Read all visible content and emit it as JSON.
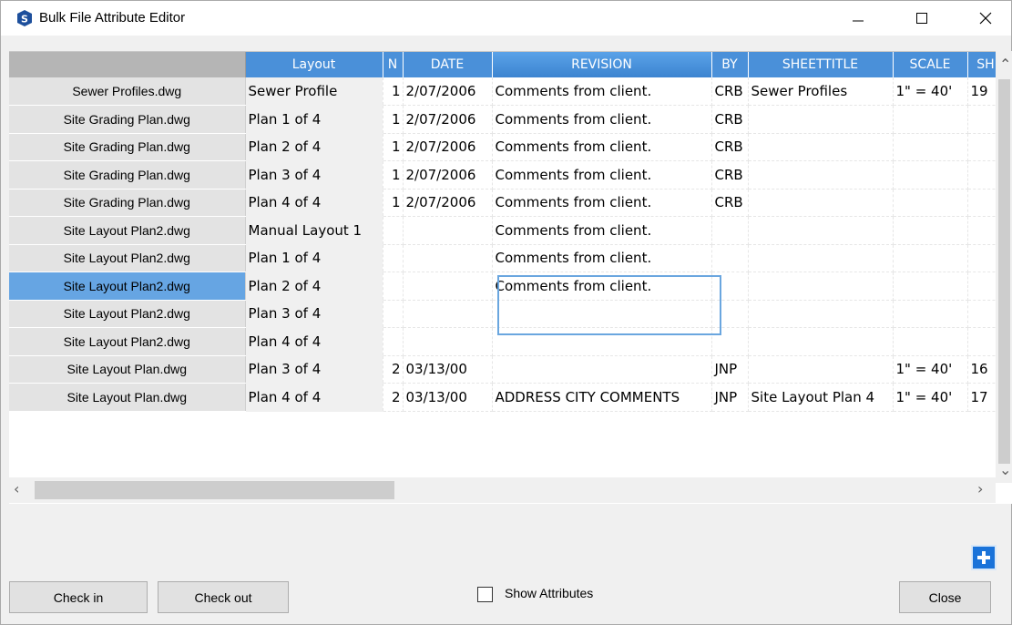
{
  "window": {
    "title": "Bulk File Attribute Editor",
    "minimize": "—",
    "maximize": "☐",
    "close": "✕"
  },
  "grid": {
    "columns": [
      "Layout",
      "N",
      "DATE",
      "REVISION",
      "BY",
      "SHEETTITLE",
      "SCALE",
      "SH"
    ],
    "rows": [
      {
        "file": "Sewer Profiles.dwg",
        "layout": "Sewer Profile",
        "n": "1",
        "date": "2/07/2006",
        "revision": "Comments from client.",
        "by": "CRB",
        "sheettitle": "Sewer Profiles",
        "scale": "1\" = 40'",
        "sh": "19"
      },
      {
        "file": "Site Grading Plan.dwg",
        "layout": "Plan 1 of 4",
        "n": "1",
        "date": "2/07/2006",
        "revision": "Comments from client.",
        "by": "CRB",
        "sheettitle": "",
        "scale": "",
        "sh": ""
      },
      {
        "file": "Site Grading Plan.dwg",
        "layout": "Plan 2 of 4",
        "n": "1",
        "date": "2/07/2006",
        "revision": "Comments from client.",
        "by": "CRB",
        "sheettitle": "",
        "scale": "",
        "sh": ""
      },
      {
        "file": "Site Grading Plan.dwg",
        "layout": "Plan 3 of 4",
        "n": "1",
        "date": "2/07/2006",
        "revision": "Comments from client.",
        "by": "CRB",
        "sheettitle": "",
        "scale": "",
        "sh": ""
      },
      {
        "file": "Site Grading Plan.dwg",
        "layout": "Plan 4 of 4",
        "n": "1",
        "date": "2/07/2006",
        "revision": "Comments from client.",
        "by": "CRB",
        "sheettitle": "",
        "scale": "",
        "sh": ""
      },
      {
        "file": "Site Layout Plan2.dwg",
        "layout": "Manual Layout 1",
        "n": "",
        "date": "",
        "revision": "Comments from client.",
        "by": "",
        "sheettitle": "",
        "scale": "",
        "sh": ""
      },
      {
        "file": "Site Layout Plan2.dwg",
        "layout": "Plan 1 of 4",
        "n": "",
        "date": "",
        "revision": "Comments from client.",
        "by": "",
        "sheettitle": "",
        "scale": "",
        "sh": ""
      },
      {
        "file": "Site Layout Plan2.dwg",
        "layout": "Plan 2 of 4",
        "n": "",
        "date": "",
        "revision": "Comments from client.",
        "by": "",
        "sheettitle": "",
        "scale": "",
        "sh": "",
        "selected": true
      },
      {
        "file": "Site Layout Plan2.dwg",
        "layout": "Plan 3 of 4",
        "n": "",
        "date": "",
        "revision": "",
        "by": "",
        "sheettitle": "",
        "scale": "",
        "sh": ""
      },
      {
        "file": "Site Layout Plan2.dwg",
        "layout": "Plan 4 of 4",
        "n": "",
        "date": "",
        "revision": "",
        "by": "",
        "sheettitle": "",
        "scale": "",
        "sh": ""
      },
      {
        "file": "Site Layout Plan.dwg",
        "layout": "Plan 3 of 4",
        "n": "2",
        "date": "03/13/00",
        "revision": "",
        "by": "JNP",
        "sheettitle": "",
        "scale": "1\" = 40'",
        "sh": "16"
      },
      {
        "file": "Site Layout Plan.dwg",
        "layout": "Plan 4 of 4",
        "n": "2",
        "date": "03/13/00",
        "revision": "ADDRESS CITY COMMENTS",
        "by": "JNP",
        "sheettitle": "Site Layout Plan 4",
        "scale": "1\" = 40'",
        "sh": "17"
      }
    ]
  },
  "buttons": {
    "check_in": "Check in",
    "check_out": "Check out",
    "close": "Close"
  },
  "show_attributes": {
    "label": "Show Attributes",
    "checked": false
  },
  "colors": {
    "header": "#4a90d9",
    "selected_row": "#66a5e3",
    "add_button": "#1a73d9"
  }
}
